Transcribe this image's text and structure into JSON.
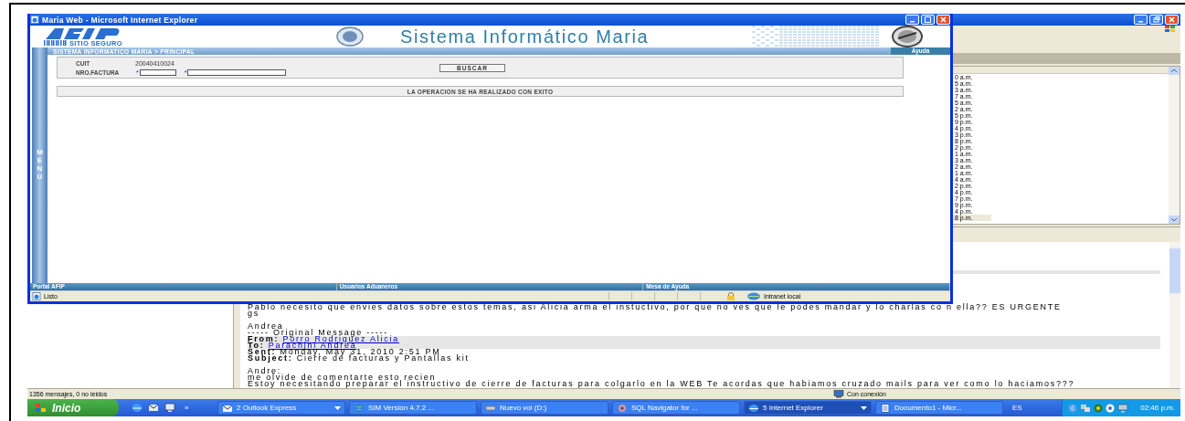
{
  "ie_window": {
    "title": "Maria Web - Microsoft Internet Explorer",
    "header": {
      "seal_caption": "SITIO SEGURO",
      "title": "Sistema Informático Maria"
    },
    "breadcrumb": "SISTEMA INFORMATICO MARIA > PRINCIPAL",
    "help_button": "Ayuda",
    "side_menu": "MENU",
    "form": {
      "fields": [
        {
          "kind": "value",
          "label": "CUIT",
          "value": "20040410024"
        },
        {
          "kind": "inputs",
          "label": "NRO.FACTURA",
          "inputs": [
            {
              "marker": "*"
            },
            {
              "marker": "*"
            }
          ]
        }
      ],
      "button": "BUSCAR"
    },
    "message": "LA OPERACION SE HA REALIZADO CON EXITO",
    "footer_links": [
      "Portal AFIP",
      "Usuarios Aduaneros",
      "Mesa de Ayuda"
    ],
    "status": {
      "text": "Listo",
      "zone": "Intranet local"
    }
  },
  "outlook_window": {
    "message_times": [
      {
        "time": "0 a.m.",
        "selected": false
      },
      {
        "time": "5 a.m.",
        "selected": false
      },
      {
        "time": "3 a.m.",
        "selected": false
      },
      {
        "time": "7 a.m.",
        "selected": false
      },
      {
        "time": "5 a.m.",
        "selected": false
      },
      {
        "time": "2 a.m.",
        "selected": false
      },
      {
        "time": "5 p.m.",
        "selected": false
      },
      {
        "time": "9 p.m.",
        "selected": false
      },
      {
        "time": "4 p.m.",
        "selected": false
      },
      {
        "time": "3 p.m.",
        "selected": false
      },
      {
        "time": "8 p.m.",
        "selected": false
      },
      {
        "time": "2 p.m.",
        "selected": false
      },
      {
        "time": "1 a.m.",
        "selected": false
      },
      {
        "time": "3 a.m.",
        "selected": false
      },
      {
        "time": "2 a.m.",
        "selected": false
      },
      {
        "time": "1 a.m.",
        "selected": false
      },
      {
        "time": "4 a.m.",
        "selected": false
      },
      {
        "time": "2 p.m.",
        "selected": false
      },
      {
        "time": "4 p.m.",
        "selected": false
      },
      {
        "time": "7 p.m.",
        "selected": false
      },
      {
        "time": "9 p.m.",
        "selected": false
      },
      {
        "time": "4 p.m.",
        "selected": false
      },
      {
        "time": "8 p.m.",
        "selected": true
      }
    ],
    "preview": [
      {
        "kind": "text",
        "text": "Pablo necesito que envies datos sobre estos temas, asi Alicia arma el instuctivo, por que no ves que le podes mandar y lo charlas co n ella?? ES URGENTE"
      },
      {
        "kind": "text",
        "text": "gs"
      },
      {
        "kind": "blank"
      },
      {
        "kind": "text",
        "text": "Andrea"
      },
      {
        "kind": "text",
        "text": "----- Original Message -----"
      },
      {
        "kind": "header",
        "label": "From:",
        "value": "Porro Rodriguez Alicia",
        "link": true
      },
      {
        "kind": "header",
        "label": "To:",
        "value": "Parachini Andrea",
        "link": true
      },
      {
        "kind": "header",
        "label": "Sent:",
        "value": "Monday, May 31, 2010 2:51 PM",
        "link": false
      },
      {
        "kind": "header",
        "label": "Subject:",
        "value": "Cierre de facturas y Pantallas kit",
        "link": false
      },
      {
        "kind": "blank"
      },
      {
        "kind": "text",
        "text": "Andre:"
      },
      {
        "kind": "text",
        "text": "me olvide de comentarte esto recien"
      },
      {
        "kind": "text",
        "text": "Estoy necesitando preparar el instructivo de cierre de facturas para colgarlo en la WEB Te acordas que habiamos cruzado mails para ver como lo haciamos???"
      }
    ],
    "status_messages": "1356 mensajes, 0 no leidos",
    "status_connection": "Con conexión"
  },
  "taskbar": {
    "start": "Inicio",
    "more": "»",
    "buttons": [
      {
        "label": "2 Outlook Express",
        "selected": false,
        "menu": true
      },
      {
        "label": "SIM Versión 4.7.2 ...",
        "selected": false,
        "menu": false
      },
      {
        "label": "Nuevo vol (D:)",
        "selected": false,
        "menu": false
      },
      {
        "label": "SQL Navigator for ...",
        "selected": false,
        "menu": false
      },
      {
        "label": "5 Internet Explorer",
        "selected": true,
        "menu": true
      },
      {
        "label": "Documento1 - Micr...",
        "selected": false,
        "menu": false
      }
    ],
    "language": "ES",
    "clock": "02:46 p.m."
  }
}
